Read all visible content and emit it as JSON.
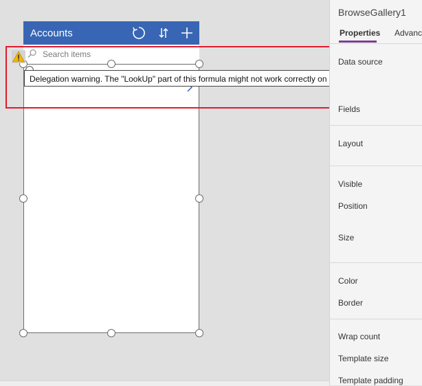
{
  "app": {
    "screen_title": "Accounts",
    "search_placeholder": "Search items",
    "icons": [
      "refresh-icon",
      "sort-icon",
      "add-icon",
      "search-icon",
      "warning-icon",
      "chevron-right-icon"
    ]
  },
  "warning": {
    "tooltip": "Delegation warning. The \"LookUp\" part of this formula might not work correctly on large data sets."
  },
  "panel": {
    "title": "BrowseGallery1",
    "tabs": [
      "Properties",
      "Advanced"
    ],
    "properties": [
      "Data source",
      "Fields",
      "Layout",
      "Visible",
      "Position",
      "Size",
      "Color",
      "Border",
      "Wrap count",
      "Template size",
      "Template padding"
    ]
  },
  "colors": {
    "header": "#3866b4",
    "highlight": "#e01b2e",
    "tab_underline": "#7b3f8f",
    "warning": "#f2b705"
  }
}
